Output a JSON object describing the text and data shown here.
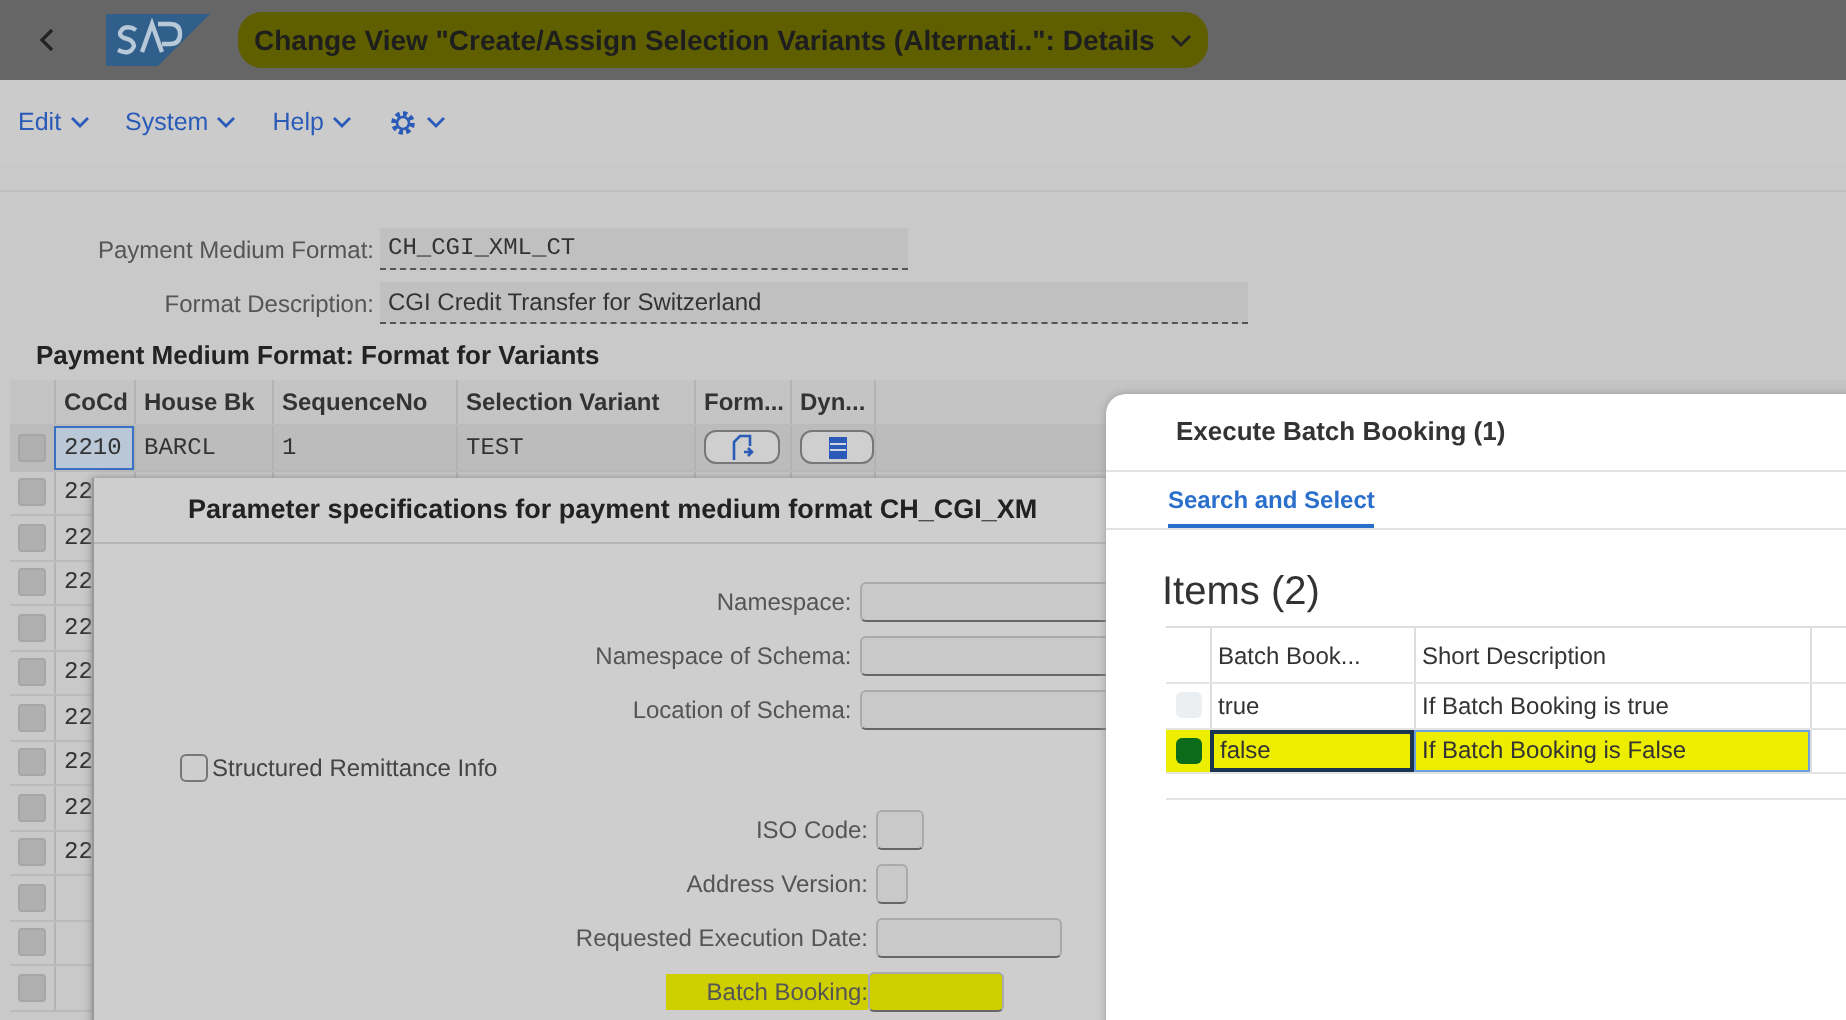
{
  "header": {
    "title": "Change View \"Create/Assign Selection Variants (Alternati..\": Details",
    "title_highlighted": true
  },
  "menu": [
    {
      "label": "Edit",
      "kind": "text"
    },
    {
      "label": "System",
      "kind": "text"
    },
    {
      "label": "Help",
      "kind": "text"
    },
    {
      "kind": "gear"
    }
  ],
  "form": [
    {
      "label": "Payment Medium Format:",
      "value": "CH_CGI_XML_CT",
      "kind": "mono"
    },
    {
      "label": "Format Description:",
      "value": "CGI Credit Transfer for Switzerland",
      "kind": "text"
    }
  ],
  "section_title": "Payment Medium Format: Format for Variants",
  "table": {
    "columns": [
      "CoCd",
      "House Bk",
      "SequenceNo",
      "Selection Variant",
      "Form...",
      "Dyn..."
    ],
    "rows": [
      {
        "cocd": "2210",
        "house_bk": "BARCL",
        "sequence_no": "1",
        "selection_variant": "TEST",
        "focused": true
      },
      {
        "cocd": "22"
      },
      {
        "cocd": "22"
      },
      {
        "cocd": "22"
      },
      {
        "cocd": "22"
      },
      {
        "cocd": "22"
      },
      {
        "cocd": "22"
      },
      {
        "cocd": "22"
      },
      {
        "cocd": "22"
      },
      {
        "cocd": "22"
      },
      {},
      {},
      {}
    ]
  },
  "parameter_dialog": {
    "title": "Parameter specifications for payment medium format CH_CGI_XM",
    "fields": [
      {
        "label": "Namespace:",
        "kind": "wide"
      },
      {
        "label": "Namespace of Schema:",
        "kind": "wide"
      },
      {
        "label": "Location of Schema:",
        "kind": "wide"
      },
      {
        "label": "Structured Remittance Info",
        "kind": "checkbox",
        "checked": false
      },
      {
        "label": "ISO Code:",
        "kind": "small"
      },
      {
        "label": "Address Version:",
        "kind": "tiny"
      },
      {
        "label": "Requested Execution Date:",
        "kind": "medium"
      },
      {
        "label": "Batch Booking:",
        "kind": "small-wide",
        "highlighted": true
      }
    ]
  },
  "value_help": {
    "title": "Execute Batch Booking (1)",
    "tabs": [
      {
        "label": "Search and Select",
        "selected": true
      }
    ],
    "items_title": "Items (2)",
    "columns": [
      "Batch Book...",
      "Short Description"
    ],
    "rows": [
      {
        "value": "true",
        "description": "If Batch Booking is true",
        "selected": false,
        "highlighted": false
      },
      {
        "value": "false",
        "description": "If Batch Booking is False",
        "selected": true,
        "highlighted": true
      }
    ]
  }
}
